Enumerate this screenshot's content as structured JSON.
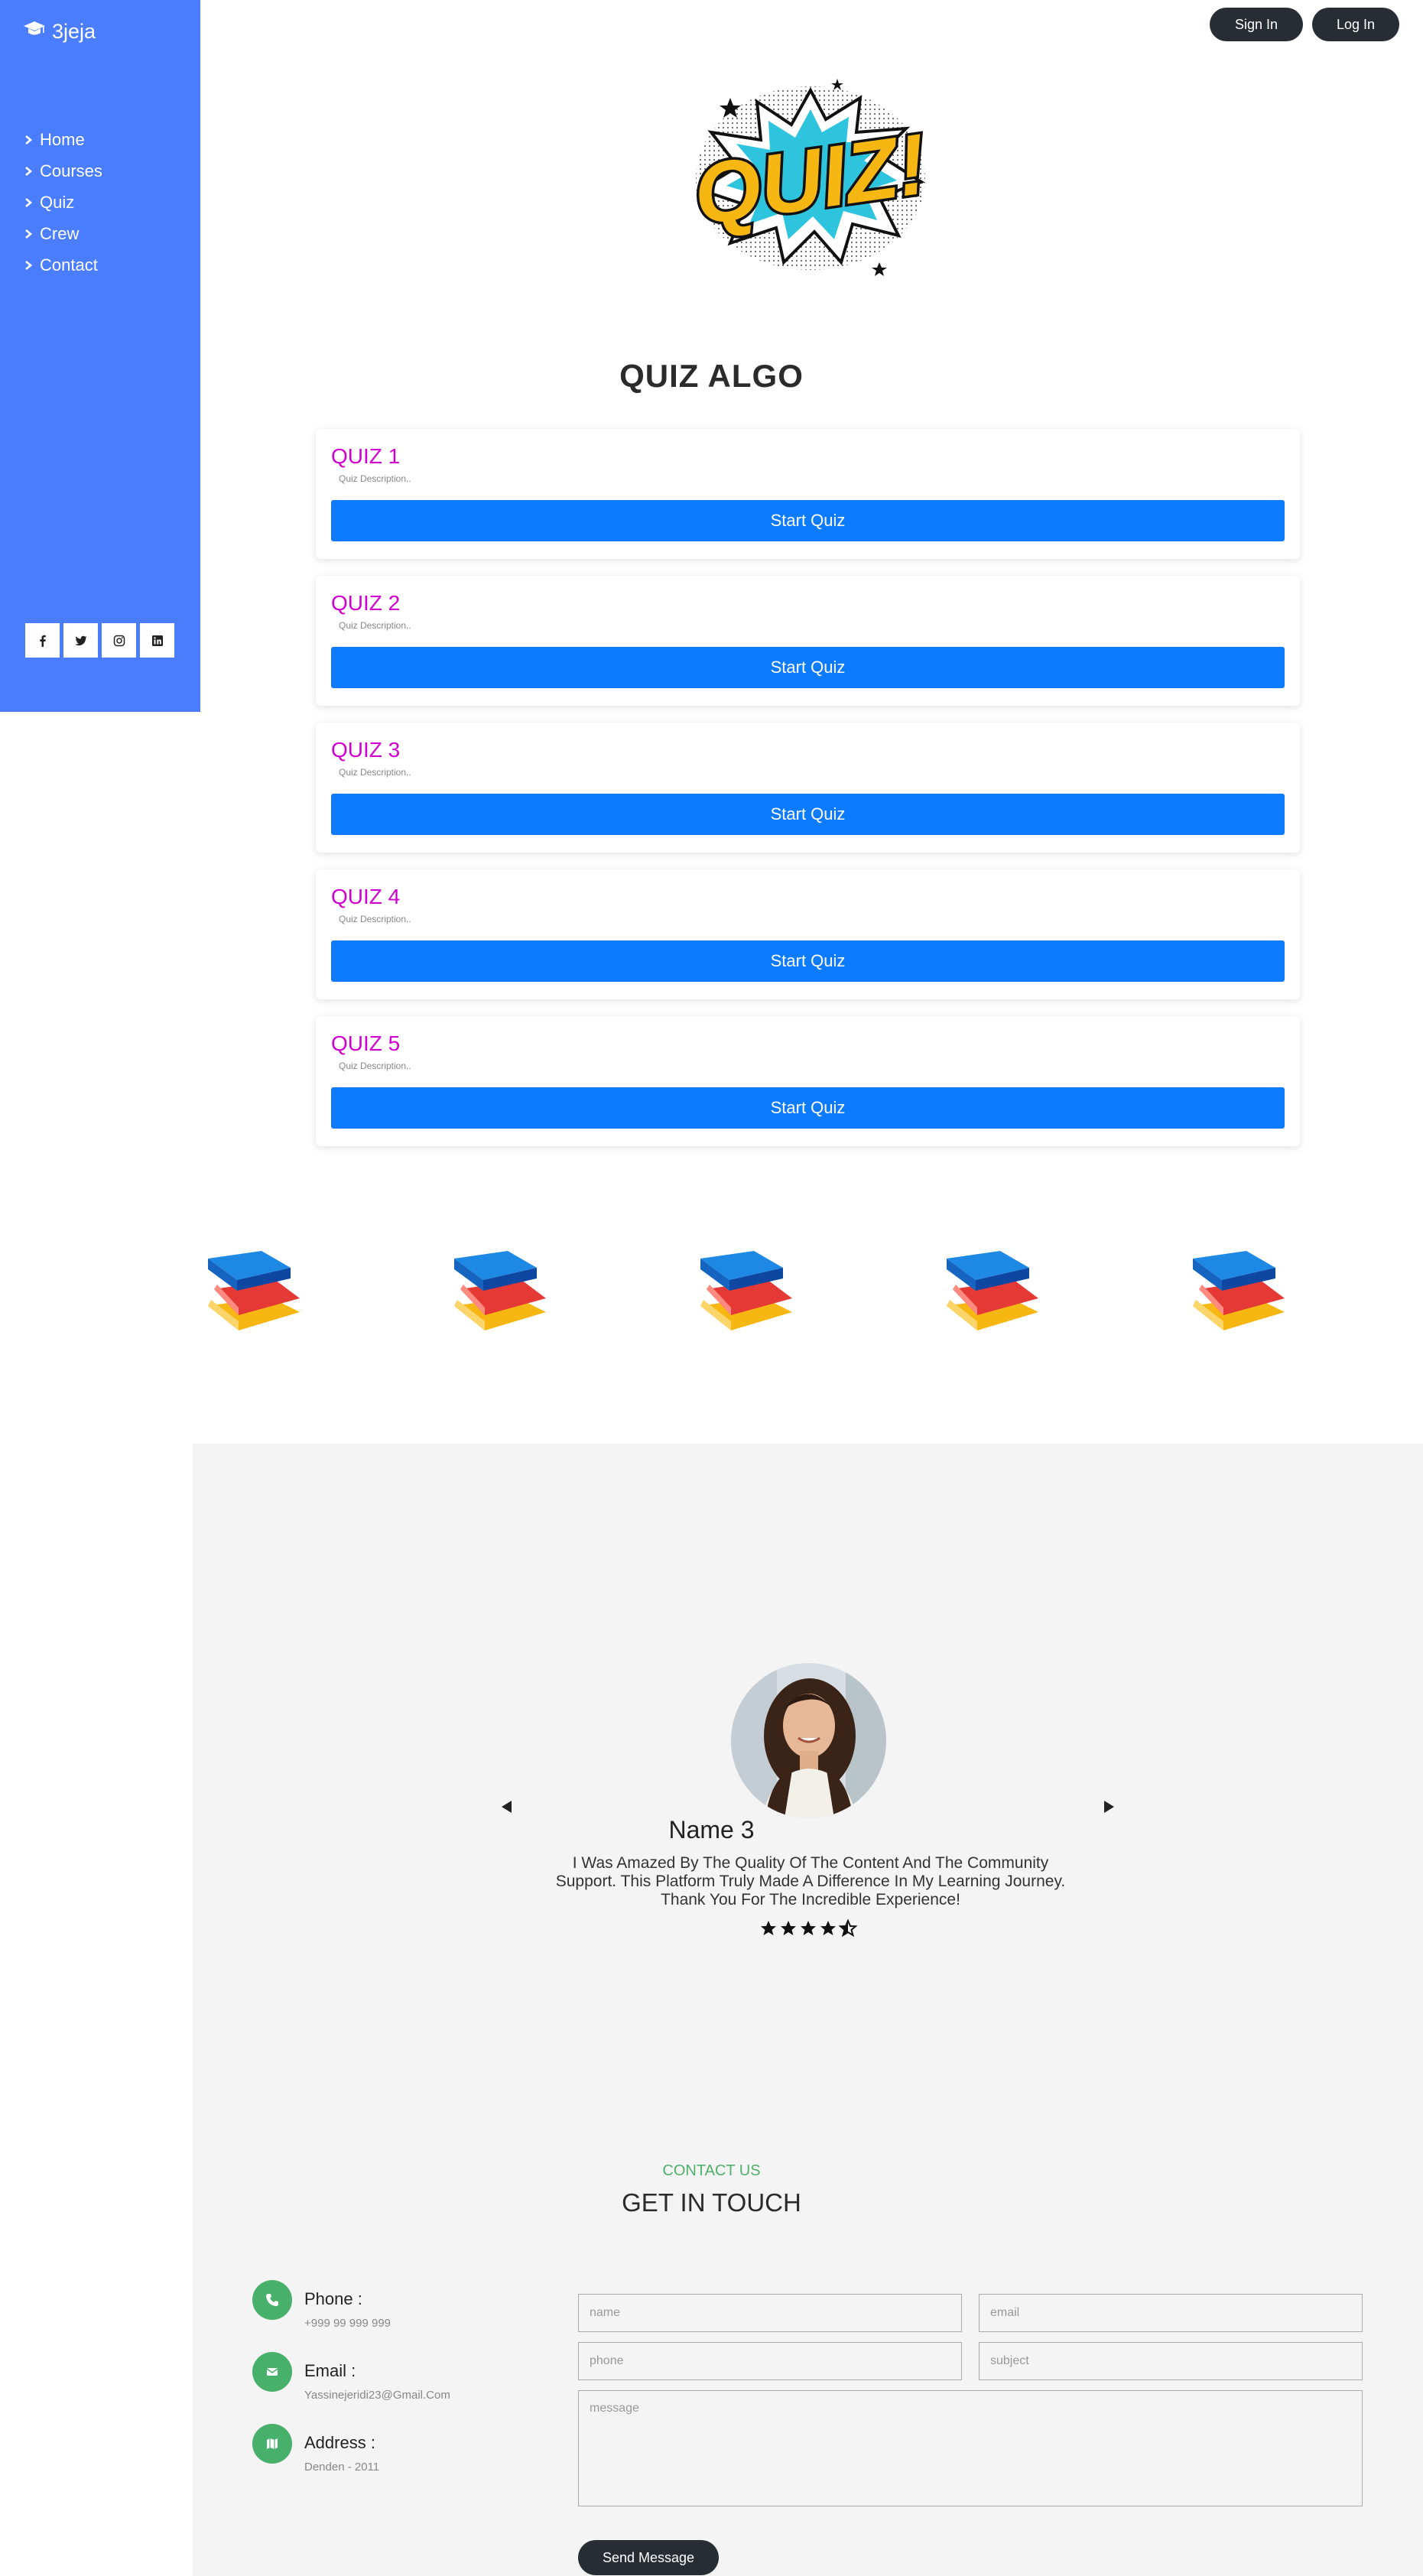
{
  "brand": {
    "name": "3jeja",
    "icon": "graduation-cap-icon"
  },
  "nav": [
    {
      "label": "Home"
    },
    {
      "label": "Courses"
    },
    {
      "label": "Quiz"
    },
    {
      "label": "Crew"
    },
    {
      "label": "Contact"
    }
  ],
  "socials": [
    "facebook-icon",
    "twitter-icon",
    "instagram-icon",
    "linkedin-icon"
  ],
  "header": {
    "signin_label": "Sign In",
    "login_label": "Log In"
  },
  "logo_text": "QUIZ!",
  "page_title": "QUIZ ALGO",
  "quizzes": [
    {
      "title": "QUIZ 1",
      "desc": "Quiz Description..",
      "button": "Start Quiz"
    },
    {
      "title": "QUIZ 2",
      "desc": "Quiz Description..",
      "button": "Start Quiz"
    },
    {
      "title": "QUIZ 3",
      "desc": "Quiz Description..",
      "button": "Start Quiz"
    },
    {
      "title": "QUIZ 4",
      "desc": "Quiz Description..",
      "button": "Start Quiz"
    },
    {
      "title": "QUIZ 5",
      "desc": "Quiz Description..",
      "button": "Start Quiz"
    }
  ],
  "testimonial": {
    "name": "Name 3",
    "text": "I Was Amazed By The Quality Of The Content And The Community Support. This Platform Truly Made A Difference In My Learning Journey. Thank You For The Incredible Experience!",
    "rating": 4.5
  },
  "contact": {
    "kicker": "CONTACT US",
    "title": "GET IN TOUCH",
    "phone_label": "Phone :",
    "phone_value": "+999 99 999 999",
    "email_label": "Email :",
    "email_value": "Yassinejeridi23@Gmail.Com",
    "address_label": "Address :",
    "address_value": "Denden - 2011",
    "placeholders": {
      "name": "name",
      "email": "email",
      "phone": "phone",
      "subject": "subject",
      "message": "message"
    },
    "send_label": "Send Message"
  },
  "colors": {
    "sidebar": "#4a7dff",
    "quiz_title": "#d100d1",
    "primary_button": "#0d7bff",
    "dark_button": "#272d33",
    "accent_green": "#47b06a"
  }
}
